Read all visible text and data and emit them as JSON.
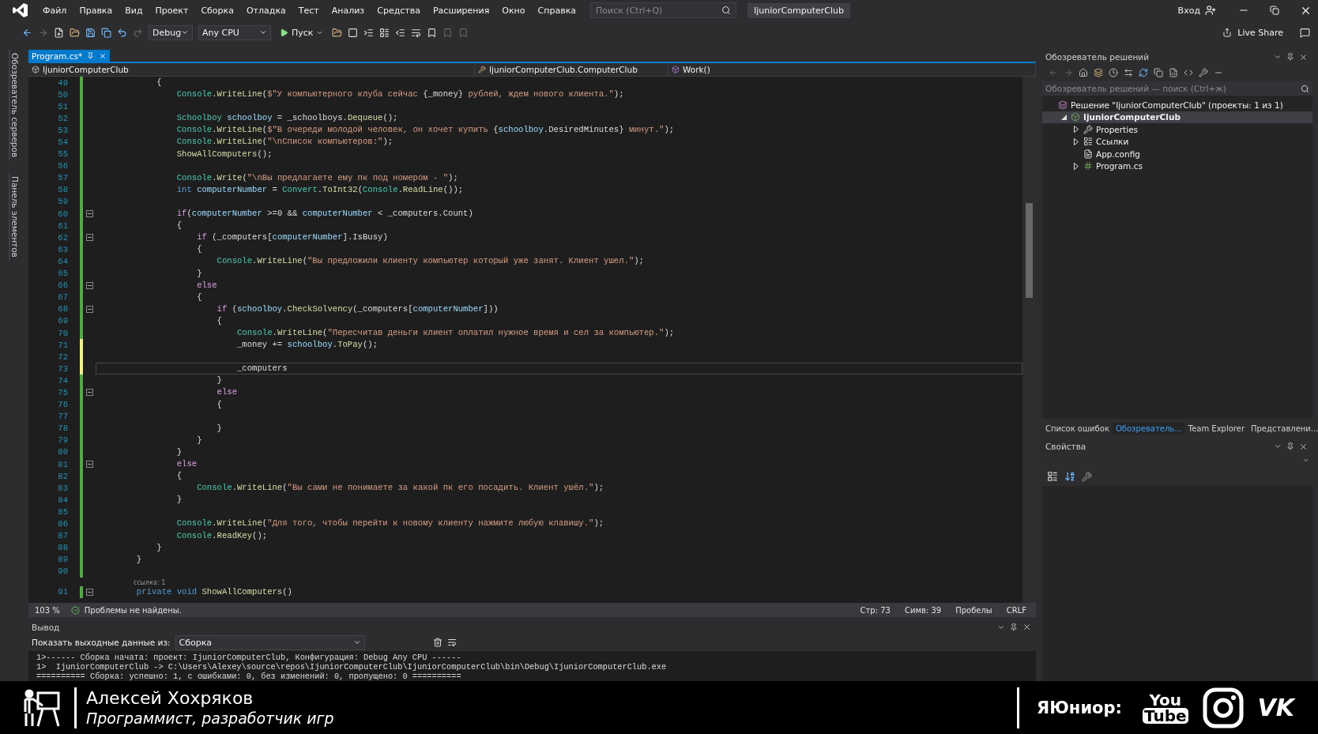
{
  "menu_bar": {
    "items": [
      "Файл",
      "Правка",
      "Вид",
      "Проект",
      "Сборка",
      "Отладка",
      "Тест",
      "Анализ",
      "Средства",
      "Расширения",
      "Окно",
      "Справка"
    ],
    "search": {
      "placeholder": "Поиск (Ctrl+Q)"
    },
    "solution_name": "IjuniorComputerClub",
    "sign_in": "Вход"
  },
  "toolbar": {
    "configuration": "Debug",
    "platform": "Any CPU",
    "start": "Пуск",
    "live_share": "Live Share"
  },
  "side_strip": [
    "Обозреватель серверов",
    "Панель элементов"
  ],
  "editor": {
    "tabs": [
      {
        "label": "Program.cs*",
        "selected": true
      }
    ],
    "nav": {
      "project": "IjuniorComputerClub",
      "class": "IjuniorComputerClub.ComputerClub",
      "member": "Work()"
    },
    "lines": [
      {
        "number": "49",
        "unsaved": false,
        "tokens": [
          {
            "kind": "plain",
            "text": "            {"
          }
        ]
      },
      {
        "number": "50",
        "unsaved": false,
        "tokens": [
          {
            "kind": "type",
            "text": "                Console"
          },
          {
            "kind": "plain",
            "text": "."
          },
          {
            "kind": "method",
            "text": "WriteLine"
          },
          {
            "kind": "plain",
            "text": "("
          },
          {
            "kind": "string",
            "text": "$\"У компьютерного клуба сейчас "
          },
          {
            "kind": "plain",
            "text": "{_money}"
          },
          {
            "kind": "string",
            "text": " рублей, ждем нового клиента.\""
          },
          {
            "kind": "plain",
            "text": ");"
          }
        ]
      },
      {
        "number": "51",
        "unsaved": false
      },
      {
        "number": "52",
        "unsaved": false,
        "tokens": [
          {
            "kind": "type",
            "text": "                Schoolboy"
          },
          {
            "kind": "variable",
            "text": " schoolboy"
          },
          {
            "kind": "plain",
            "text": " = _schoolboys."
          },
          {
            "kind": "method",
            "text": "Dequeue"
          },
          {
            "kind": "plain",
            "text": "();"
          }
        ]
      },
      {
        "number": "53",
        "unsaved": false,
        "tokens": [
          {
            "kind": "type",
            "text": "                Console"
          },
          {
            "kind": "plain",
            "text": "."
          },
          {
            "kind": "method",
            "text": "WriteLine"
          },
          {
            "kind": "plain",
            "text": "("
          },
          {
            "kind": "string",
            "text": "$\"В очереди молодой человек, он хочет купить "
          },
          {
            "kind": "plain",
            "text": "{"
          },
          {
            "kind": "variable",
            "text": "schoolboy"
          },
          {
            "kind": "plain",
            "text": ".DesiredMinutes}"
          },
          {
            "kind": "string",
            "text": " минут.\""
          },
          {
            "kind": "plain",
            "text": ");"
          }
        ]
      },
      {
        "number": "54",
        "unsaved": false,
        "tokens": [
          {
            "kind": "type",
            "text": "                Console"
          },
          {
            "kind": "plain",
            "text": "."
          },
          {
            "kind": "method",
            "text": "WriteLine"
          },
          {
            "kind": "plain",
            "text": "("
          },
          {
            "kind": "string",
            "text": "\"\\nСписок компьютеров:\""
          },
          {
            "kind": "plain",
            "text": ");"
          }
        ]
      },
      {
        "number": "55",
        "unsaved": false,
        "tokens": [
          {
            "kind": "method",
            "text": "                ShowAllComputers"
          },
          {
            "kind": "plain",
            "text": "();"
          }
        ]
      },
      {
        "number": "56",
        "unsaved": false
      },
      {
        "number": "57",
        "unsaved": false,
        "tokens": [
          {
            "kind": "type",
            "text": "                Console"
          },
          {
            "kind": "plain",
            "text": "."
          },
          {
            "kind": "method",
            "text": "Write"
          },
          {
            "kind": "plain",
            "text": "("
          },
          {
            "kind": "string",
            "text": "\"\\nВы предлагаете ему пк под номером - \""
          },
          {
            "kind": "plain",
            "text": ");"
          }
        ]
      },
      {
        "number": "58",
        "unsaved": false,
        "tokens": [
          {
            "kind": "keyword",
            "text": "                int"
          },
          {
            "kind": "variable",
            "text": " computerNumber"
          },
          {
            "kind": "plain",
            "text": " = "
          },
          {
            "kind": "type",
            "text": "Convert"
          },
          {
            "kind": "plain",
            "text": "."
          },
          {
            "kind": "method",
            "text": "ToInt32"
          },
          {
            "kind": "plain",
            "text": "("
          },
          {
            "kind": "type",
            "text": "Console"
          },
          {
            "kind": "plain",
            "text": "."
          },
          {
            "kind": "method",
            "text": "ReadLine"
          },
          {
            "kind": "plain",
            "text": "());"
          }
        ]
      },
      {
        "number": "59",
        "unsaved": false
      },
      {
        "number": "60",
        "unsaved": false,
        "foldable": true,
        "tokens": [
          {
            "kind": "control",
            "text": "                if"
          },
          {
            "kind": "plain",
            "text": "("
          },
          {
            "kind": "variable",
            "text": "computerNumber"
          },
          {
            "kind": "plain",
            "text": " >=0 && "
          },
          {
            "kind": "variable",
            "text": "computerNumber"
          },
          {
            "kind": "plain",
            "text": " < _computers.Count)"
          }
        ]
      },
      {
        "number": "61",
        "unsaved": false,
        "tokens": [
          {
            "kind": "plain",
            "text": "                {"
          }
        ]
      },
      {
        "number": "62",
        "unsaved": false,
        "foldable": true,
        "tokens": [
          {
            "kind": "control",
            "text": "                    if"
          },
          {
            "kind": "plain",
            "text": " (_computers["
          },
          {
            "kind": "variable",
            "text": "computerNumber"
          },
          {
            "kind": "plain",
            "text": "].IsBusy)"
          }
        ]
      },
      {
        "number": "63",
        "unsaved": false,
        "tokens": [
          {
            "kind": "plain",
            "text": "                    {"
          }
        ]
      },
      {
        "number": "64",
        "unsaved": false,
        "tokens": [
          {
            "kind": "type",
            "text": "                        Console"
          },
          {
            "kind": "plain",
            "text": "."
          },
          {
            "kind": "method",
            "text": "WriteLine"
          },
          {
            "kind": "plain",
            "text": "("
          },
          {
            "kind": "string",
            "text": "\"Вы предложили клиенту компьютер который уже занят. Клиент ушел.\""
          },
          {
            "kind": "plain",
            "text": ");"
          }
        ]
      },
      {
        "number": "65",
        "unsaved": false,
        "tokens": [
          {
            "kind": "plain",
            "text": "                    }"
          }
        ]
      },
      {
        "number": "66",
        "unsaved": false,
        "foldable": true,
        "tokens": [
          {
            "kind": "control",
            "text": "                    else"
          }
        ]
      },
      {
        "number": "67",
        "unsaved": false,
        "tokens": [
          {
            "kind": "plain",
            "text": "                    {"
          }
        ]
      },
      {
        "number": "68",
        "unsaved": false,
        "foldable": true,
        "tokens": [
          {
            "kind": "control",
            "text": "                        if"
          },
          {
            "kind": "plain",
            "text": " ("
          },
          {
            "kind": "variable",
            "text": "schoolboy"
          },
          {
            "kind": "plain",
            "text": "."
          },
          {
            "kind": "method",
            "text": "CheckSolvency"
          },
          {
            "kind": "plain",
            "text": "(_computers["
          },
          {
            "kind": "variable",
            "text": "computerNumber"
          },
          {
            "kind": "plain",
            "text": "]))"
          }
        ]
      },
      {
        "number": "69",
        "unsaved": false,
        "tokens": [
          {
            "kind": "plain",
            "text": "                        {"
          }
        ]
      },
      {
        "number": "70",
        "unsaved": false,
        "tokens": [
          {
            "kind": "type",
            "text": "                            Console"
          },
          {
            "kind": "plain",
            "text": "."
          },
          {
            "kind": "method",
            "text": "WriteLine"
          },
          {
            "kind": "plain",
            "text": "("
          },
          {
            "kind": "string",
            "text": "\"Пересчитав деньги клиент оплатил нужное время и сел за компьютер.\""
          },
          {
            "kind": "plain",
            "text": ");"
          }
        ]
      },
      {
        "number": "71",
        "unsaved": true,
        "tokens": [
          {
            "kind": "plain",
            "text": "                            _money += "
          },
          {
            "kind": "variable",
            "text": "schoolboy"
          },
          {
            "kind": "plain",
            "text": "."
          },
          {
            "kind": "method",
            "text": "ToPay"
          },
          {
            "kind": "plain",
            "text": "();"
          }
        ]
      },
      {
        "number": "72",
        "unsaved": true
      },
      {
        "number": "73",
        "unsaved": true,
        "current": true,
        "tokens": [
          {
            "kind": "plain",
            "text": "                            _computers"
          }
        ]
      },
      {
        "number": "74",
        "unsaved": false,
        "tokens": [
          {
            "kind": "plain",
            "text": "                        }"
          }
        ]
      },
      {
        "number": "75",
        "unsaved": false,
        "foldable": true,
        "tokens": [
          {
            "kind": "control",
            "text": "                        else"
          }
        ]
      },
      {
        "number": "76",
        "unsaved": false,
        "tokens": [
          {
            "kind": "plain",
            "text": "                        {"
          }
        ]
      },
      {
        "number": "77",
        "unsaved": false
      },
      {
        "number": "78",
        "unsaved": false,
        "tokens": [
          {
            "kind": "plain",
            "text": "                        }"
          }
        ]
      },
      {
        "number": "79",
        "unsaved": false,
        "tokens": [
          {
            "kind": "plain",
            "text": "                    }"
          }
        ]
      },
      {
        "number": "80",
        "unsaved": false,
        "tokens": [
          {
            "kind": "plain",
            "text": "                }"
          }
        ]
      },
      {
        "number": "81",
        "unsaved": false,
        "foldable": true,
        "tokens": [
          {
            "kind": "control",
            "text": "                else"
          }
        ]
      },
      {
        "number": "82",
        "unsaved": false,
        "tokens": [
          {
            "kind": "plain",
            "text": "                {"
          }
        ]
      },
      {
        "number": "83",
        "unsaved": false,
        "tokens": [
          {
            "kind": "type",
            "text": "                    Console"
          },
          {
            "kind": "plain",
            "text": "."
          },
          {
            "kind": "method",
            "text": "WriteLine"
          },
          {
            "kind": "plain",
            "text": "("
          },
          {
            "kind": "string",
            "text": "\"Вы сами не понимаете за какой пк его посадить. Клиент ушёл.\""
          },
          {
            "kind": "plain",
            "text": ");"
          }
        ]
      },
      {
        "number": "84",
        "unsaved": false,
        "tokens": [
          {
            "kind": "plain",
            "text": "                }"
          }
        ]
      },
      {
        "number": "85",
        "unsaved": false
      },
      {
        "number": "86",
        "unsaved": false,
        "tokens": [
          {
            "kind": "type",
            "text": "                Console"
          },
          {
            "kind": "plain",
            "text": "."
          },
          {
            "kind": "method",
            "text": "WriteLine"
          },
          {
            "kind": "plain",
            "text": "("
          },
          {
            "kind": "string",
            "text": "\"Для того, чтобы перейти к новому клиенту нажмите любую клавишу.\""
          },
          {
            "kind": "plain",
            "text": ");"
          }
        ]
      },
      {
        "number": "87",
        "unsaved": false,
        "tokens": [
          {
            "kind": "type",
            "text": "                Console"
          },
          {
            "kind": "plain",
            "text": "."
          },
          {
            "kind": "method",
            "text": "ReadKey"
          },
          {
            "kind": "plain",
            "text": "();"
          }
        ]
      },
      {
        "number": "88",
        "unsaved": false,
        "tokens": [
          {
            "kind": "plain",
            "text": "            }"
          }
        ]
      },
      {
        "number": "89",
        "unsaved": false,
        "tokens": [
          {
            "kind": "plain",
            "text": "        }"
          }
        ]
      },
      {
        "number": "90",
        "unsaved": false
      },
      {
        "number": "91",
        "unsaved": false,
        "foldable": true,
        "codelens": "ссылка: 1",
        "tokens": [
          {
            "kind": "keyword",
            "text": "        private"
          },
          {
            "kind": "keyword",
            "text": " void"
          },
          {
            "kind": "method",
            "text": " ShowAllComputers"
          },
          {
            "kind": "plain",
            "text": "()"
          }
        ]
      }
    ],
    "status": {
      "zoom": "103 %",
      "issues": "Проблемы не найдены.",
      "line": "Стр: 73",
      "column": "Симв: 39",
      "indent": "Пробелы",
      "line_ending": "CRLF"
    }
  },
  "output": {
    "title": "Вывод",
    "source_label": "Показать выходные данные из:",
    "source": "Сборка",
    "lines": [
      "1>------ Сборка начата: проект: IjuniorComputerClub, Конфигурация: Debug Any CPU ------",
      "1>  IjuniorComputerClub -> C:\\Users\\Alexey\\source\\repos\\IjuniorComputerClub\\IjuniorComputerClub\\bin\\Debug\\IjuniorComputerClub.exe",
      "========== Сборка: успешно: 1, с ошибками: 0, без изменений: 0, пропущено: 0 =========="
    ]
  },
  "solution_explorer": {
    "title": "Обозреватель решений",
    "search": {
      "placeholder": "Обозреватель решений — поиск (Ctrl+ж)"
    },
    "tree": [
      {
        "label": "Решение \"IjuniorComputerClub\" (проекты: 1 из 1)",
        "kind": "solution",
        "selected": false,
        "children": [
          {
            "label": "IjuniorComputerClub",
            "kind": "project",
            "expanded": true,
            "selected": true,
            "children": [
              {
                "label": "Properties",
                "kind": "properties",
                "expanded": false,
                "selected": false
              },
              {
                "label": "Ссылки",
                "kind": "references",
                "expanded": false,
                "selected": false
              },
              {
                "label": "App.config",
                "kind": "config",
                "selected": false
              },
              {
                "label": "Program.cs",
                "kind": "csharp",
                "expanded": false,
                "selected": false
              }
            ]
          }
        ]
      }
    ]
  },
  "panel_tabs": [
    {
      "label": "Список ошибок",
      "selected": false
    },
    {
      "label": "Обозреватель...",
      "selected": true
    },
    {
      "label": "Team Explorer",
      "selected": false
    },
    {
      "label": "Представлени...",
      "selected": false
    }
  ],
  "properties": {
    "title": "Свойства"
  },
  "banner": {
    "name": "Алексей Хохряков",
    "role": "Программист, разработчик игр",
    "channel": "ЯЮниор:",
    "youtube": [
      "You",
      "Tube"
    ],
    "vk": "VK"
  }
}
